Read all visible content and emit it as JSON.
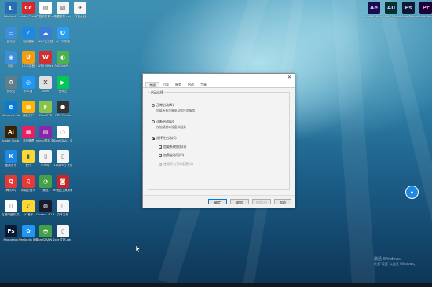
{
  "desktop": {
    "icons": [
      {
        "label": "Administ...",
        "color": "#2a6db5",
        "glyph": "◧",
        "col": 0,
        "row": 0
      },
      {
        "label": "Adobe Creati...",
        "color": "#d8262d",
        "glyph": "Cc",
        "col": 1,
        "row": 0
      },
      {
        "label": "文档和素材.xlsx",
        "color": "#ffffff",
        "glyph": "▤",
        "col": 2,
        "row": 0
      },
      {
        "label": "配置参数.png",
        "color": "#f2f2f2",
        "glyph": "▧",
        "col": 3,
        "row": 0
      },
      {
        "label": "飞机大战",
        "color": "#f5f5f5",
        "glyph": "✈",
        "col": 4,
        "row": 0
      },
      {
        "label": "此电脑",
        "color": "#3b8ed8",
        "glyph": "▭",
        "col": 0,
        "row": 1
      },
      {
        "label": "电脑管家",
        "color": "#1e88e5",
        "glyph": "✓",
        "col": 1,
        "row": 1
      },
      {
        "label": "WPS云文档",
        "color": "#3a7bd5",
        "glyph": "☁",
        "col": 2,
        "row": 1
      },
      {
        "label": "QQ 浏览器",
        "color": "#2a9df4",
        "glyph": "Q",
        "col": 3,
        "row": 1
      },
      {
        "label": "网络",
        "color": "#3b8ed8",
        "glyph": "◉",
        "col": 0,
        "row": 2
      },
      {
        "label": "UC浏览器",
        "color": "#f39c12",
        "glyph": "U",
        "col": 1,
        "row": 2
      },
      {
        "label": "WPS Office",
        "color": "#d32f2f",
        "glyph": "W",
        "col": 2,
        "row": 2
      },
      {
        "label": "360DiskPr...",
        "color": "#4caf50",
        "glyph": "◐",
        "col": 3,
        "row": 2
      },
      {
        "label": "回收站",
        "color": "#607d8b",
        "glyph": "♻",
        "col": 0,
        "row": 3
      },
      {
        "label": "什么值",
        "color": "#2196f3",
        "glyph": "◎",
        "col": 1,
        "row": 3
      },
      {
        "label": "Xshell",
        "color": "#e0e0e0",
        "glyph": "X",
        "col": 2,
        "row": 3
      },
      {
        "label": "爱奇艺",
        "color": "#00c853",
        "glyph": "▶",
        "col": 3,
        "row": 3
      },
      {
        "label": "Microsoft Edge",
        "color": "#0b7bd1",
        "glyph": "e",
        "col": 0,
        "row": 4
      },
      {
        "label": "我的工厂",
        "color": "#ffb300",
        "glyph": "▦",
        "col": 1,
        "row": 4
      },
      {
        "label": "FlashFXP",
        "color": "#8bc34a",
        "glyph": "F",
        "col": 2,
        "row": 4
      },
      {
        "label": "OBS Studio",
        "color": "#333333",
        "glyph": "●",
        "col": 3,
        "row": 4
      },
      {
        "label": "Adobe Illustrat...",
        "color": "#3a1f00",
        "glyph": "Ai",
        "col": 0,
        "row": 5
      },
      {
        "label": "游戏管理",
        "color": "#e91e63",
        "glyph": "▩",
        "col": 1,
        "row": 5
      },
      {
        "label": "micsd鼠标 中键插件.rar",
        "color": "#8e24aa",
        "glyph": "▤",
        "col": 2,
        "row": 5
      },
      {
        "label": "CorelDRA... 中键工具",
        "color": "#ffffff",
        "glyph": "◌",
        "col": 3,
        "row": 5
      },
      {
        "label": "酷狗音乐",
        "color": "#1e88e5",
        "glyph": "K",
        "col": 0,
        "row": 6
      },
      {
        "label": "爱什",
        "color": "#fdd835",
        "glyph": "▮",
        "col": 1,
        "row": 6
      },
      {
        "label": "curlkjt",
        "color": "#f5f5f5",
        "glyph": "▯",
        "col": 2,
        "row": 6
      },
      {
        "label": "12月16日 天标题.docx",
        "color": "#f5f5f5",
        "glyph": "▯",
        "col": 3,
        "row": 6
      },
      {
        "label": "腾讯QQ",
        "color": "#e53935",
        "glyph": "Q",
        "col": 0,
        "row": 7
      },
      {
        "label": "网易云音乐",
        "color": "#e53935",
        "glyph": "♫",
        "col": 1,
        "row": 7
      },
      {
        "label": "微信",
        "color": "#43a047",
        "glyph": "◔",
        "col": 2,
        "row": 7
      },
      {
        "label": "IE截图工具新版",
        "color": "#c62828",
        "glyph": "◙",
        "col": 3,
        "row": 7
      },
      {
        "label": "百度网盘的 文件",
        "color": "#ffffff",
        "glyph": "▯",
        "col": 0,
        "row": 8
      },
      {
        "label": "QQ音乐",
        "color": "#fdd835",
        "glyph": "♪",
        "col": 1,
        "row": 8
      },
      {
        "label": "Cinema 4D R19",
        "color": "#1a1a2e",
        "glyph": "◍",
        "col": 2,
        "row": 8
      },
      {
        "label": "文本文档",
        "color": "#f5f5f5",
        "glyph": "▯",
        "col": 3,
        "row": 8
      },
      {
        "label": "Photoshop",
        "color": "#0a1a33",
        "glyph": "Ps",
        "col": 0,
        "row": 9
      },
      {
        "label": "VeeAudio 网盘",
        "color": "#2196f3",
        "glyph": "✿",
        "col": 1,
        "row": 9
      },
      {
        "label": "CorelDRAW 2017 (64-...",
        "color": "#43a047",
        "glyph": "◓",
        "col": 2,
        "row": 9
      },
      {
        "label": "cdr 文档.cdr",
        "color": "#f5f5f5",
        "glyph": "▯",
        "col": 3,
        "row": 9
      }
    ],
    "topright_icons": [
      {
        "label": "Adobe After Effects CC...",
        "color": "#1a0d4d",
        "glyph": "Ae"
      },
      {
        "label": "Adobe Audition...",
        "color": "#00312e",
        "glyph": "Au"
      },
      {
        "label": "Adobe Photoshop...",
        "color": "#0a1a33",
        "glyph": "Ps"
      },
      {
        "label": "Adobe Premiere...",
        "color": "#1f0033",
        "glyph": "Pr"
      }
    ],
    "watermark": {
      "line1": "激活 Windows",
      "line2": "转到\"设置\"以激活 Windows。"
    },
    "float_button": "●"
  },
  "dialog": {
    "close": "✕",
    "tabs": [
      "常规",
      "引导",
      "服务",
      "启动",
      "工具"
    ],
    "group_title": "启动选择",
    "options": {
      "normal": {
        "label": "正常启动(N)",
        "desc": "加载所有设备驱动程序和服务"
      },
      "diagnostic": {
        "label": "诊断启动(D)",
        "desc": "仅加载基本设备和服务"
      },
      "selective": {
        "label": "选择性启动(S)"
      },
      "load_services": "加载系统服务(L)",
      "load_startup": "加载启动项(O)",
      "original_boot": "使用原有引导配置(U)"
    },
    "buttons": {
      "ok": "确定",
      "cancel": "取消",
      "apply": "应用(A)",
      "help": "帮助"
    }
  }
}
